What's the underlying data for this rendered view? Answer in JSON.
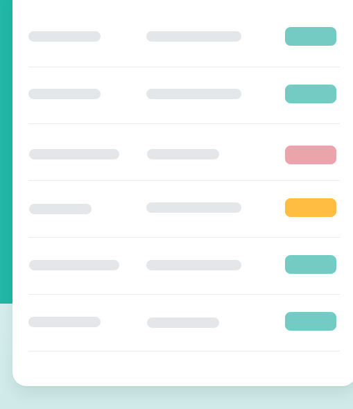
{
  "colors": {
    "background_accent": "#21b9a7",
    "background_soft": "#d3ecea",
    "card": "#ffffff",
    "placeholder": "#e3e7ea",
    "divider": "#e9edf0"
  },
  "table": {
    "rows": [
      {
        "status": {
          "color": "#74cbc3",
          "meaning": "success"
        }
      },
      {
        "status": {
          "color": "#74cbc3",
          "meaning": "success"
        }
      },
      {
        "status": {
          "color": "#eba4ab",
          "meaning": "error"
        }
      },
      {
        "status": {
          "color": "#ffbe41",
          "meaning": "warning"
        }
      },
      {
        "status": {
          "color": "#74cbc3",
          "meaning": "success"
        }
      },
      {
        "status": {
          "color": "#74cbc3",
          "meaning": "success"
        }
      }
    ]
  }
}
